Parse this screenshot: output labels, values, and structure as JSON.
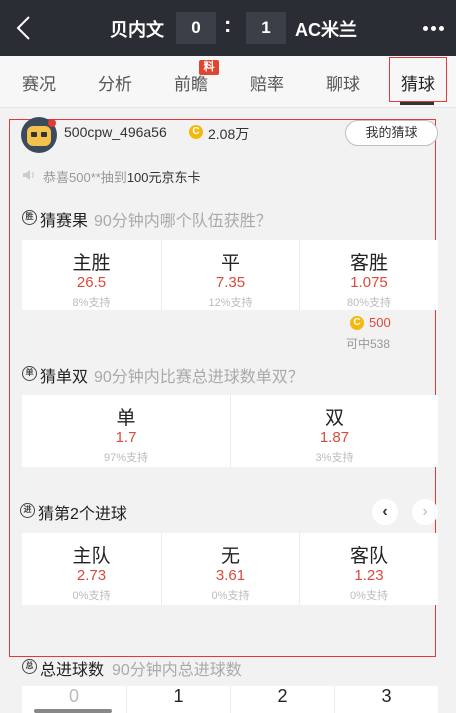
{
  "header": {
    "home_team": "贝内文",
    "home_score": "0",
    "separator": ":",
    "away_score": "1",
    "away_team": "AC米兰"
  },
  "tabs": [
    {
      "label": "赛况"
    },
    {
      "label": "分析"
    },
    {
      "label": "前瞻",
      "badge": "料"
    },
    {
      "label": "赔率"
    },
    {
      "label": "聊球"
    },
    {
      "label": "猜球",
      "active": true
    }
  ],
  "user": {
    "name": "500cpw_496a56",
    "coin_symbol": "C",
    "coins": "2.08万",
    "my_guess_button": "我的猜球"
  },
  "notice": {
    "prefix": "恭喜500**抽到",
    "prize": "100元京东卡"
  },
  "sections": {
    "result": {
      "icon_text": "胜",
      "title": "猜赛果",
      "subtitle": "90分钟内哪个队伍获胜？",
      "options": [
        {
          "label": "主胜",
          "odds": "26.5",
          "support": "8%支持"
        },
        {
          "label": "平",
          "odds": "7.35",
          "support": "12%支持"
        },
        {
          "label": "客胜",
          "odds": "1.075",
          "support": "80%支持"
        }
      ],
      "stake": "500",
      "stake_win": "可中538"
    },
    "odd_even": {
      "icon_text": "单",
      "title": "猜单双",
      "subtitle": "90分钟内比赛总进球数单双？",
      "options": [
        {
          "label": "单",
          "odds": "1.7",
          "support": "97%支持"
        },
        {
          "label": "双",
          "odds": "1.87",
          "support": "3%支持"
        }
      ]
    },
    "second_goal": {
      "icon_text": "进",
      "title": "猜第2个进球",
      "options": [
        {
          "label": "主队",
          "odds": "2.73",
          "support": "0%支持"
        },
        {
          "label": "无",
          "odds": "3.61",
          "support": "0%支持"
        },
        {
          "label": "客队",
          "odds": "1.23",
          "support": "0%支持"
        }
      ]
    },
    "total_goals": {
      "icon_text": "总",
      "title": "总进球数",
      "subtitle": "90分钟内总进球数",
      "options": [
        "0",
        "1",
        "2",
        "3"
      ]
    }
  },
  "colors": {
    "header_bg": "#2a2d33",
    "odds": "#d94a3a",
    "coin": "#f5b90e",
    "highlight_frame": "#e03a3a"
  }
}
